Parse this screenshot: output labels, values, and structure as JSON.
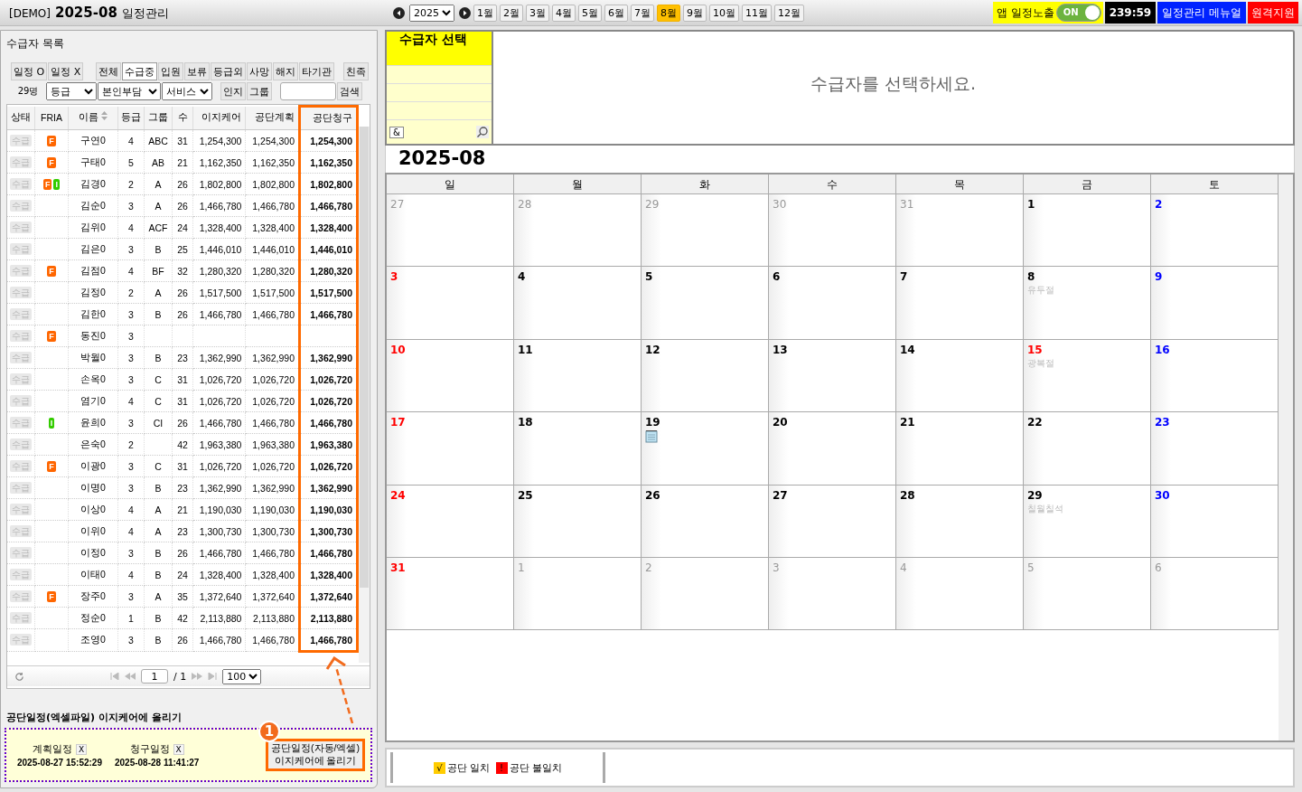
{
  "header": {
    "demo": "[DEMO]",
    "month": "2025-08",
    "title": "일정관리",
    "year": "2025",
    "months": [
      {
        "label": "1월",
        "selected": false
      },
      {
        "label": "2월",
        "selected": false
      },
      {
        "label": "3월",
        "selected": false
      },
      {
        "label": "4월",
        "selected": false
      },
      {
        "label": "5월",
        "selected": false
      },
      {
        "label": "6월",
        "selected": false
      },
      {
        "label": "7월",
        "selected": false
      },
      {
        "label": "8월",
        "selected": true
      },
      {
        "label": "9월",
        "selected": false
      },
      {
        "label": "10월",
        "selected": false
      },
      {
        "label": "11월",
        "selected": false
      },
      {
        "label": "12월",
        "selected": false
      }
    ],
    "app_toggle": {
      "label": "앱 일정노출",
      "state": "ON",
      "on": true
    },
    "timer": "239:59",
    "manual": "일정관리 메뉴얼",
    "support": "원격지원"
  },
  "list_panel": {
    "title": "수급자 목록",
    "schedule_filters": [
      {
        "label": "일정 O",
        "selected": false
      },
      {
        "label": "일정 X",
        "selected": false
      }
    ],
    "status_filters": [
      {
        "label": "전체",
        "selected": false
      },
      {
        "label": "수급중",
        "selected": true
      },
      {
        "label": "입원",
        "selected": false
      },
      {
        "label": "보류",
        "selected": false
      },
      {
        "label": "등급외",
        "selected": false
      },
      {
        "label": "사망",
        "selected": false
      },
      {
        "label": "해지",
        "selected": false
      },
      {
        "label": "타기관",
        "selected": false
      }
    ],
    "family": "친족",
    "count": "29명",
    "selects": [
      "등급",
      "본인부담",
      "서비스"
    ],
    "approval": "인지",
    "group": "그룹",
    "search": "검색",
    "columns": [
      "상태",
      "FRIA",
      "이름",
      "등급",
      "그룹",
      "수",
      "이지케어",
      "공단계획",
      "공단청구"
    ],
    "rows": [
      {
        "status": "수급",
        "badges": [
          {
            "label": "F",
            "color": "#ff6600"
          }
        ],
        "name": "구연0",
        "grade": "4",
        "group": "ABC",
        "n": "31",
        "easycare": "1,254,300",
        "plan": "1,254,300",
        "claim": "1,254,300"
      },
      {
        "status": "수급",
        "badges": [
          {
            "label": "F",
            "color": "#ff6600"
          }
        ],
        "name": "구태0",
        "grade": "5",
        "group": "AB",
        "n": "21",
        "easycare": "1,162,350",
        "plan": "1,162,350",
        "claim": "1,162,350"
      },
      {
        "status": "수급",
        "badges": [
          {
            "label": "F",
            "color": "#ff6600"
          },
          {
            "label": "I",
            "color": "#33cc00"
          }
        ],
        "name": "김경0",
        "grade": "2",
        "group": "A",
        "n": "26",
        "easycare": "1,802,800",
        "plan": "1,802,800",
        "claim": "1,802,800"
      },
      {
        "status": "수급",
        "badges": [],
        "name": "김순0",
        "grade": "3",
        "group": "A",
        "n": "26",
        "easycare": "1,466,780",
        "plan": "1,466,780",
        "claim": "1,466,780"
      },
      {
        "status": "수급",
        "badges": [],
        "name": "김위0",
        "grade": "4",
        "group": "ACF",
        "n": "24",
        "easycare": "1,328,400",
        "plan": "1,328,400",
        "claim": "1,328,400"
      },
      {
        "status": "수급",
        "badges": [],
        "name": "김은0",
        "grade": "3",
        "group": "B",
        "n": "25",
        "easycare": "1,446,010",
        "plan": "1,446,010",
        "claim": "1,446,010"
      },
      {
        "status": "수급",
        "badges": [
          {
            "label": "F",
            "color": "#ff6600"
          }
        ],
        "name": "김점0",
        "grade": "4",
        "group": "BF",
        "n": "32",
        "easycare": "1,280,320",
        "plan": "1,280,320",
        "claim": "1,280,320"
      },
      {
        "status": "수급",
        "badges": [],
        "name": "김정0",
        "grade": "2",
        "group": "A",
        "n": "26",
        "easycare": "1,517,500",
        "plan": "1,517,500",
        "claim": "1,517,500"
      },
      {
        "status": "수급",
        "badges": [],
        "name": "김한0",
        "grade": "3",
        "group": "B",
        "n": "26",
        "easycare": "1,466,780",
        "plan": "1,466,780",
        "claim": "1,466,780"
      },
      {
        "status": "수급",
        "badges": [
          {
            "label": "F",
            "color": "#ff6600"
          }
        ],
        "name": "동진0",
        "grade": "3",
        "group": "",
        "n": "",
        "easycare": "",
        "plan": "",
        "claim": ""
      },
      {
        "status": "수급",
        "badges": [],
        "name": "박월0",
        "grade": "3",
        "group": "B",
        "n": "23",
        "easycare": "1,362,990",
        "plan": "1,362,990",
        "claim": "1,362,990"
      },
      {
        "status": "수급",
        "badges": [],
        "name": "손옥0",
        "grade": "3",
        "group": "C",
        "n": "31",
        "easycare": "1,026,720",
        "plan": "1,026,720",
        "claim": "1,026,720"
      },
      {
        "status": "수급",
        "badges": [],
        "name": "염기0",
        "grade": "4",
        "group": "C",
        "n": "31",
        "easycare": "1,026,720",
        "plan": "1,026,720",
        "claim": "1,026,720"
      },
      {
        "status": "수급",
        "badges": [
          {
            "label": "I",
            "color": "#33cc00"
          }
        ],
        "name": "윤희0",
        "grade": "3",
        "group": "CI",
        "n": "26",
        "easycare": "1,466,780",
        "plan": "1,466,780",
        "claim": "1,466,780"
      },
      {
        "status": "수급",
        "badges": [],
        "name": "은숙0",
        "grade": "2",
        "group": "",
        "n": "42",
        "easycare": "1,963,380",
        "plan": "1,963,380",
        "claim": "1,963,380"
      },
      {
        "status": "수급",
        "badges": [
          {
            "label": "F",
            "color": "#ff6600"
          }
        ],
        "name": "이광0",
        "grade": "3",
        "group": "C",
        "n": "31",
        "easycare": "1,026,720",
        "plan": "1,026,720",
        "claim": "1,026,720"
      },
      {
        "status": "수급",
        "badges": [],
        "name": "이명0",
        "grade": "3",
        "group": "B",
        "n": "23",
        "easycare": "1,362,990",
        "plan": "1,362,990",
        "claim": "1,362,990"
      },
      {
        "status": "수급",
        "badges": [],
        "name": "이상0",
        "grade": "4",
        "group": "A",
        "n": "21",
        "easycare": "1,190,030",
        "plan": "1,190,030",
        "claim": "1,190,030"
      },
      {
        "status": "수급",
        "badges": [],
        "name": "이위0",
        "grade": "4",
        "group": "A",
        "n": "23",
        "easycare": "1,300,730",
        "plan": "1,300,730",
        "claim": "1,300,730"
      },
      {
        "status": "수급",
        "badges": [],
        "name": "이정0",
        "grade": "3",
        "group": "B",
        "n": "26",
        "easycare": "1,466,780",
        "plan": "1,466,780",
        "claim": "1,466,780"
      },
      {
        "status": "수급",
        "badges": [],
        "name": "이태0",
        "grade": "4",
        "group": "B",
        "n": "24",
        "easycare": "1,328,400",
        "plan": "1,328,400",
        "claim": "1,328,400"
      },
      {
        "status": "수급",
        "badges": [
          {
            "label": "F",
            "color": "#ff6600"
          }
        ],
        "name": "장주0",
        "grade": "3",
        "group": "A",
        "n": "35",
        "easycare": "1,372,640",
        "plan": "1,372,640",
        "claim": "1,372,640"
      },
      {
        "status": "수급",
        "badges": [],
        "name": "정순0",
        "grade": "1",
        "group": "B",
        "n": "42",
        "easycare": "2,113,880",
        "plan": "2,113,880",
        "claim": "2,113,880"
      },
      {
        "status": "수급",
        "badges": [],
        "name": "조영0",
        "grade": "3",
        "group": "B",
        "n": "26",
        "easycare": "1,466,780",
        "plan": "1,466,780",
        "claim": "1,466,780"
      }
    ],
    "pager": {
      "page": "1",
      "total": "/ 1",
      "size": "100"
    }
  },
  "upload": {
    "title": "공단일정(엑셀파일) 이지케어에 올리기",
    "step": "1",
    "items": [
      {
        "label": "계획일정",
        "clear": "X",
        "time": "2025-08-27 15:52:29"
      },
      {
        "label": "청구일정",
        "clear": "X",
        "time": "2025-08-28 11:41:27"
      }
    ],
    "button": [
      "공단일정(자동/엑셀)",
      "이지케어에 올리기"
    ]
  },
  "recipient": {
    "title": "수급자 선택",
    "swap": "&",
    "message": "수급자를 선택하세요."
  },
  "calendar": {
    "title": "2025-08",
    "weekdays": [
      "일",
      "월",
      "화",
      "수",
      "목",
      "금",
      "토"
    ],
    "weeks": [
      [
        {
          "day": "27",
          "muted": true
        },
        {
          "day": "28",
          "muted": true
        },
        {
          "day": "29",
          "muted": true
        },
        {
          "day": "30",
          "muted": true
        },
        {
          "day": "31",
          "muted": true
        },
        {
          "day": "1",
          "muted": false
        },
        {
          "day": "2",
          "muted": false
        }
      ],
      [
        {
          "day": "3",
          "muted": false
        },
        {
          "day": "4",
          "muted": false
        },
        {
          "day": "5",
          "muted": false
        },
        {
          "day": "6",
          "muted": false
        },
        {
          "day": "7",
          "muted": false
        },
        {
          "day": "8",
          "muted": false,
          "note": "유두절"
        },
        {
          "day": "9",
          "muted": false
        }
      ],
      [
        {
          "day": "10",
          "muted": false
        },
        {
          "day": "11",
          "muted": false
        },
        {
          "day": "12",
          "muted": false
        },
        {
          "day": "13",
          "muted": false
        },
        {
          "day": "14",
          "muted": false
        },
        {
          "day": "15",
          "muted": false,
          "holiday": true,
          "note": "광복절"
        },
        {
          "day": "16",
          "muted": false
        }
      ],
      [
        {
          "day": "17",
          "muted": false
        },
        {
          "day": "18",
          "muted": false
        },
        {
          "day": "19",
          "muted": false,
          "memo": true
        },
        {
          "day": "20",
          "muted": false
        },
        {
          "day": "21",
          "muted": false
        },
        {
          "day": "22",
          "muted": false
        },
        {
          "day": "23",
          "muted": false
        }
      ],
      [
        {
          "day": "24",
          "muted": false
        },
        {
          "day": "25",
          "muted": false
        },
        {
          "day": "26",
          "muted": false
        },
        {
          "day": "27",
          "muted": false
        },
        {
          "day": "28",
          "muted": false
        },
        {
          "day": "29",
          "muted": false,
          "note": "칠월칠석"
        },
        {
          "day": "30",
          "muted": false
        }
      ],
      [
        {
          "day": "31",
          "muted": false
        },
        {
          "day": "1",
          "muted": true
        },
        {
          "day": "2",
          "muted": true
        },
        {
          "day": "3",
          "muted": true
        },
        {
          "day": "4",
          "muted": true
        },
        {
          "day": "5",
          "muted": true
        },
        {
          "day": "6",
          "muted": true
        }
      ]
    ]
  },
  "legend": [
    {
      "mark": "√",
      "label": "공단 일치",
      "color": "#ffcc00"
    },
    {
      "mark": "!",
      "label": "공단 불일치",
      "color": "#ff0000"
    }
  ]
}
